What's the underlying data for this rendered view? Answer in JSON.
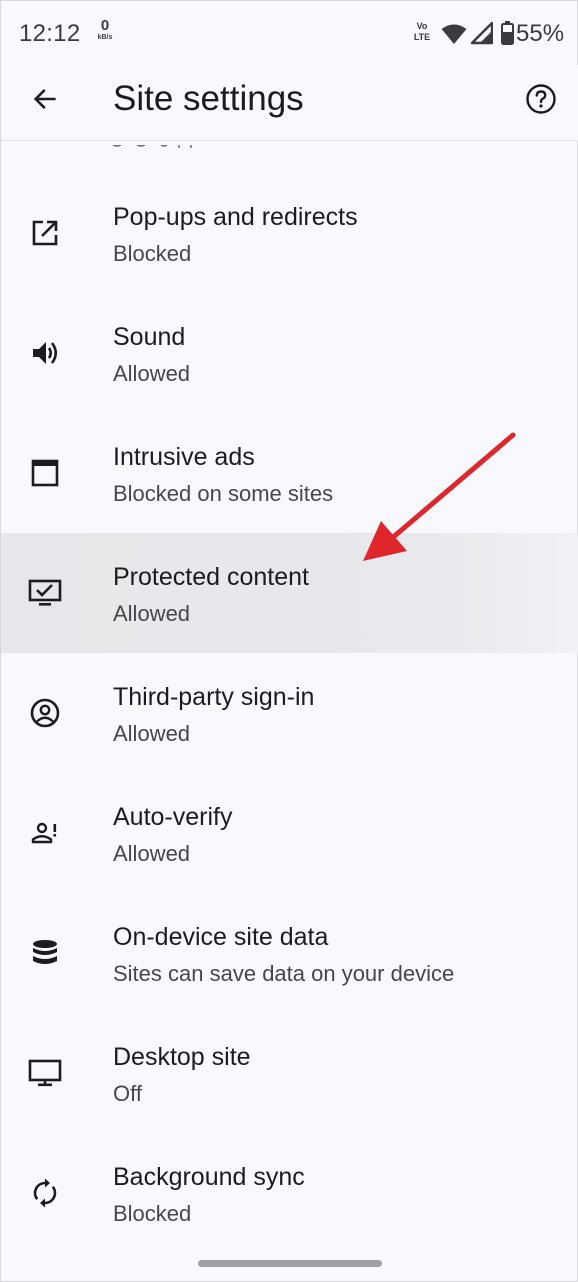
{
  "status_bar": {
    "time": "12:12",
    "net_speed_value": "0",
    "net_speed_unit": "kB/s",
    "volte_label_top": "Vo",
    "volte_label_bottom": "LTE",
    "battery_percent": "55%",
    "icons": [
      "wifi-icon",
      "signal-icon",
      "battery-icon"
    ]
  },
  "app_bar": {
    "title": "Site settings",
    "back_icon": "arrow-back-icon",
    "help_icon": "help-circle-icon"
  },
  "items": [
    {
      "title": "Pop-ups and redirects",
      "subtitle": "Blocked",
      "icon": "open-in-new-icon"
    },
    {
      "title": "Sound",
      "subtitle": "Allowed",
      "icon": "volume-icon"
    },
    {
      "title": "Intrusive ads",
      "subtitle": "Blocked on some sites",
      "icon": "window-icon"
    },
    {
      "title": "Protected content",
      "subtitle": "Allowed",
      "icon": "protected-content-icon",
      "highlighted": true
    },
    {
      "title": "Third-party sign-in",
      "subtitle": "Allowed",
      "icon": "account-circle-icon"
    },
    {
      "title": "Auto-verify",
      "subtitle": "Allowed",
      "icon": "person-alert-icon"
    },
    {
      "title": "On-device site data",
      "subtitle": "Sites can save data on your device",
      "icon": "database-icon"
    },
    {
      "title": "Desktop site",
      "subtitle": "Off",
      "icon": "desktop-icon"
    },
    {
      "title": "Background sync",
      "subtitle": "Blocked",
      "icon": "sync-icon"
    }
  ],
  "colors": {
    "background": "#f8f9fe",
    "highlight": "#e7e8eb",
    "annotation_arrow": "#e0262d",
    "text_primary": "#1b1c1f",
    "text_secondary": "#46474b"
  }
}
